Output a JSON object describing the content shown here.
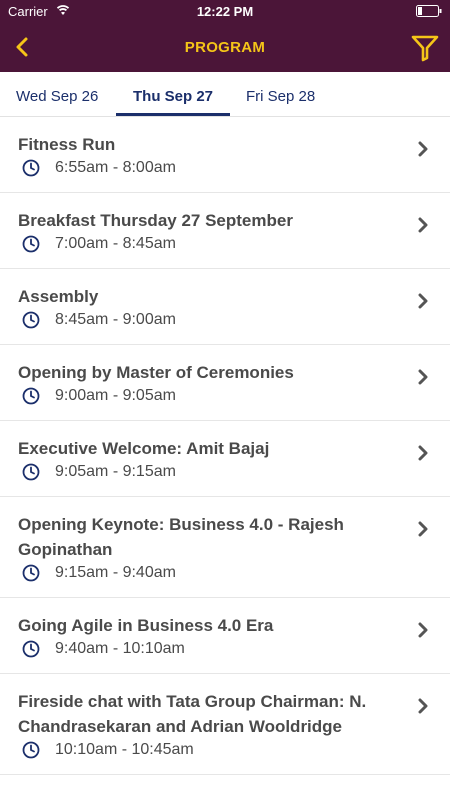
{
  "status": {
    "carrier": "Carrier",
    "time": "12:22 PM"
  },
  "header": {
    "title": "PROGRAM"
  },
  "tabs": [
    {
      "label": "Wed Sep 26",
      "active": false
    },
    {
      "label": "Thu Sep 27",
      "active": true
    },
    {
      "label": "Fri Sep 28",
      "active": false
    }
  ],
  "sessions": [
    {
      "title": "Fitness Run",
      "time": "6:55am - 8:00am"
    },
    {
      "title": "Breakfast Thursday 27 September",
      "time": "7:00am - 8:45am"
    },
    {
      "title": "Assembly",
      "time": "8:45am - 9:00am"
    },
    {
      "title": "Opening by Master of Ceremonies",
      "time": "9:00am - 9:05am"
    },
    {
      "title": "Executive Welcome: Amit Bajaj",
      "time": "9:05am - 9:15am"
    },
    {
      "title": "Opening Keynote: Business 4.0 - Rajesh Gopinathan",
      "time": "9:15am - 9:40am"
    },
    {
      "title": "Going Agile in Business 4.0 Era",
      "time": "9:40am - 10:10am"
    },
    {
      "title": "Fireside chat with Tata Group Chairman: N. Chandrasekaran and Adrian Wooldridge",
      "time": "10:10am - 10:45am"
    }
  ],
  "colors": {
    "header_bg": "#4b1538",
    "accent": "#f5c518",
    "tab_active": "#1b2f6b"
  }
}
